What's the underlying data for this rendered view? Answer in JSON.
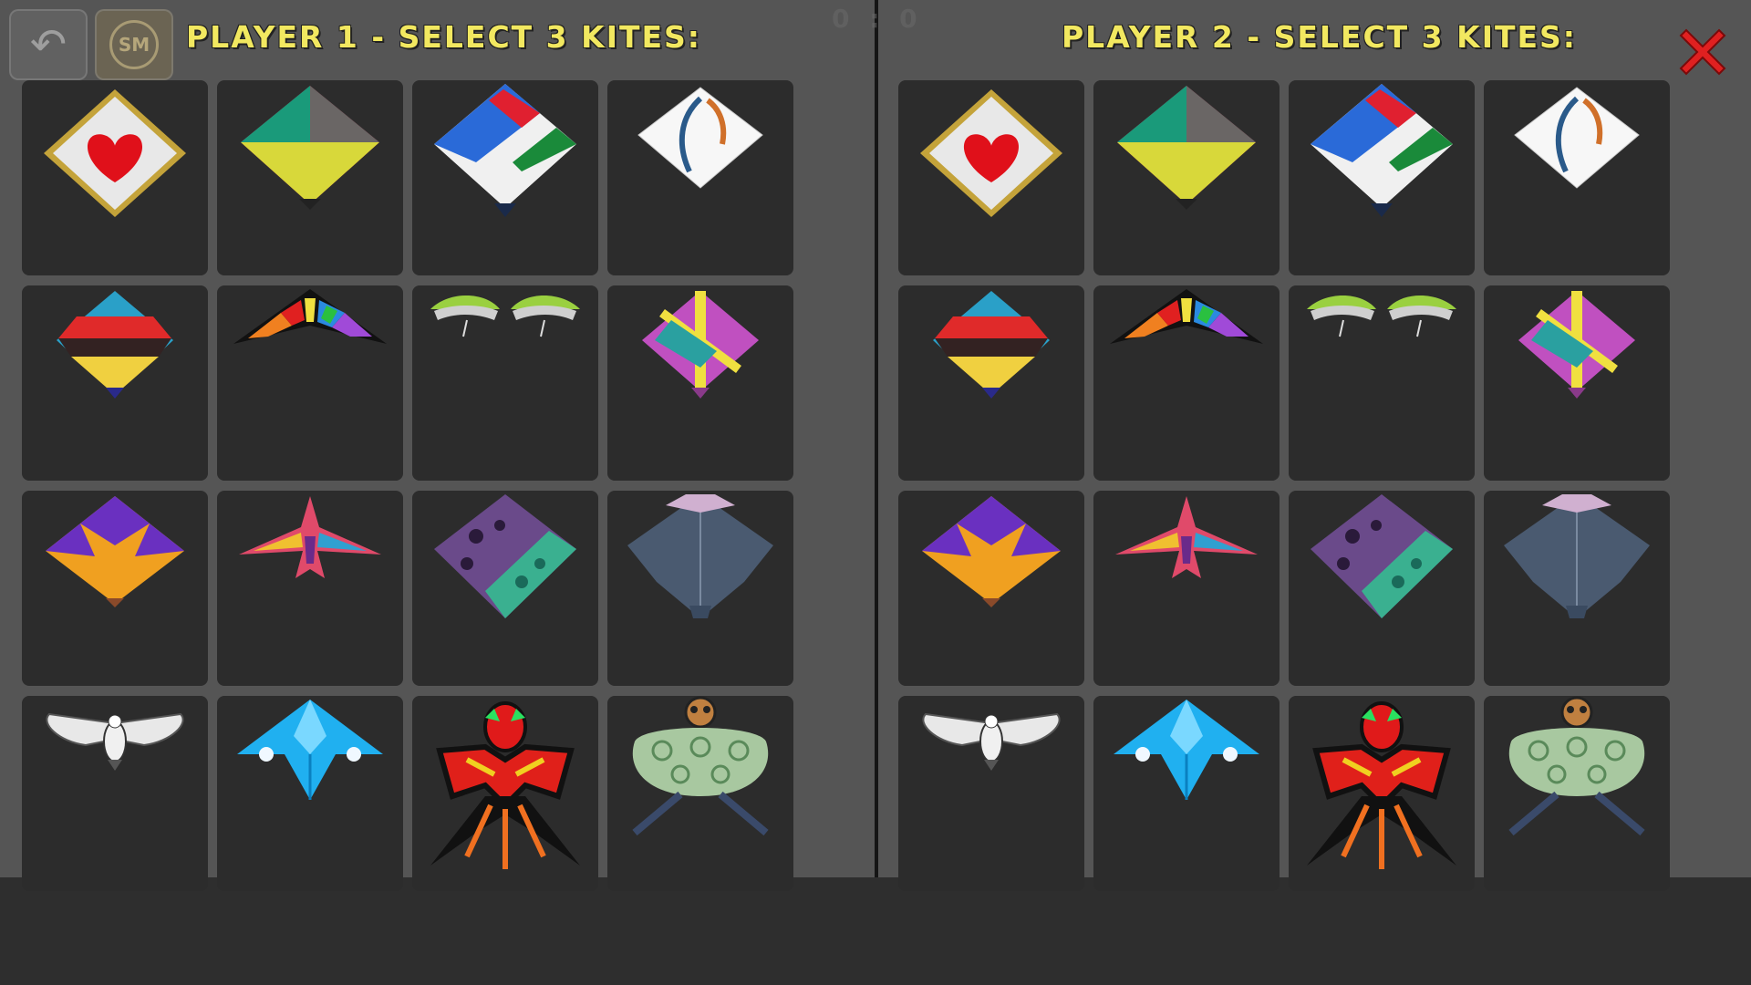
{
  "player1": {
    "title": "PLAYER 1 - SELECT 3 KITES:"
  },
  "player2": {
    "title": "PLAYER 2 - SELECT 3 KITES:"
  },
  "score": "0 : 0",
  "buttons": {
    "back_icon": "back-arrow-icon",
    "sm_label": "SM",
    "close_icon": "close-x-icon"
  },
  "colors": {
    "title": "#f2e860",
    "tile": "#2c2c2c",
    "panel": "#555555",
    "close": "#e02020"
  },
  "kites": [
    {
      "id": "heart-kite"
    },
    {
      "id": "tricolor-kite"
    },
    {
      "id": "stripe-kite"
    },
    {
      "id": "white-swoosh-kite"
    },
    {
      "id": "mustache-kite"
    },
    {
      "id": "rainbow-delta-kite"
    },
    {
      "id": "parachute-kite"
    },
    {
      "id": "cross-kite"
    },
    {
      "id": "purple-orange-kite"
    },
    {
      "id": "bird-kite"
    },
    {
      "id": "floral-kite"
    },
    {
      "id": "denim-kite"
    },
    {
      "id": "eagle-kite"
    },
    {
      "id": "blue-jet-kite"
    },
    {
      "id": "dragon-kite"
    },
    {
      "id": "peacock-kite"
    }
  ]
}
